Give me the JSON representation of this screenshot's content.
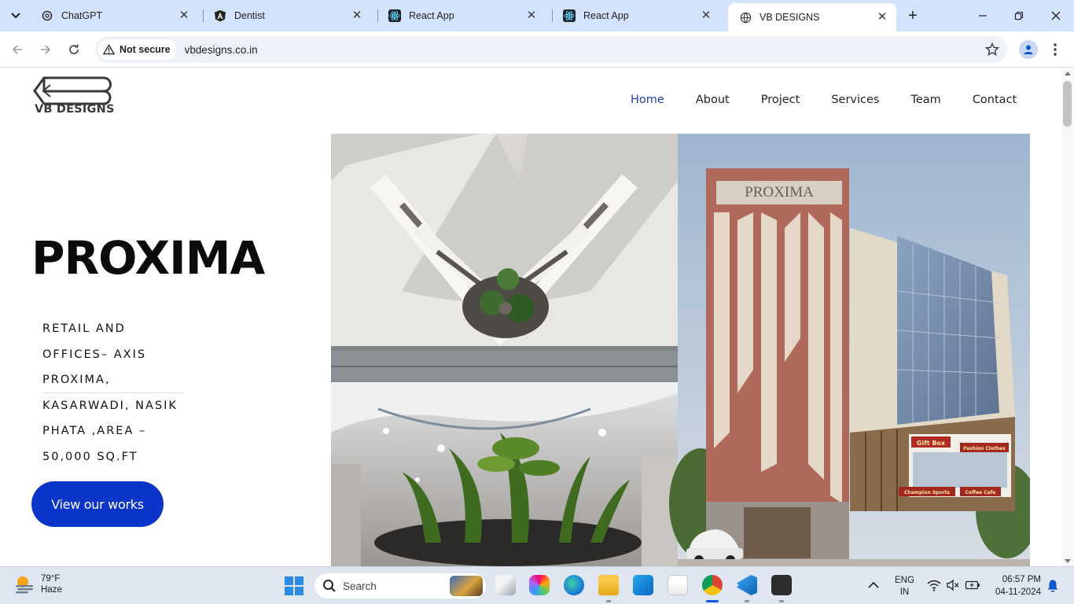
{
  "browser": {
    "tabs": [
      {
        "title": "ChatGPT",
        "icon": "chatgpt-icon"
      },
      {
        "title": "Dentist",
        "icon": "angular-icon"
      },
      {
        "title": "React App",
        "icon": "react-icon"
      },
      {
        "title": "React App",
        "icon": "react-icon"
      },
      {
        "title": "VB DESIGNS",
        "icon": "globe-icon",
        "active": true
      }
    ],
    "security_label": "Not secure",
    "url": "vbdesigns.co.in"
  },
  "site": {
    "logo_text": "VB DESIGNS",
    "nav": [
      "Home",
      "About",
      "Project",
      "Services",
      "Team",
      "Contact"
    ],
    "active_nav": "Home",
    "nav_active_color": "#1f3fb5",
    "hero": {
      "title": "PROXIMA",
      "description_lines": [
        "RETAIL AND",
        "OFFICES– AXIS",
        "PROXIMA,",
        "KASARWADI, NASIK",
        "PHATA ,AREA –",
        "50,000 SQ.FT"
      ],
      "cta_label": "View our works",
      "cta_color": "#0b35c8"
    },
    "gallery": {
      "building_sign": "PROXIMA",
      "store_signs": [
        "Gift Box",
        "Fashion Clothes",
        "Champion Sports",
        "Coffee Cafe"
      ]
    }
  },
  "taskbar": {
    "weather_temp": "79°F",
    "weather_desc": "Haze",
    "search_placeholder": "Search",
    "language": "ENG",
    "region": "IN",
    "time": "06:57 PM",
    "date": "04-11-2024"
  }
}
